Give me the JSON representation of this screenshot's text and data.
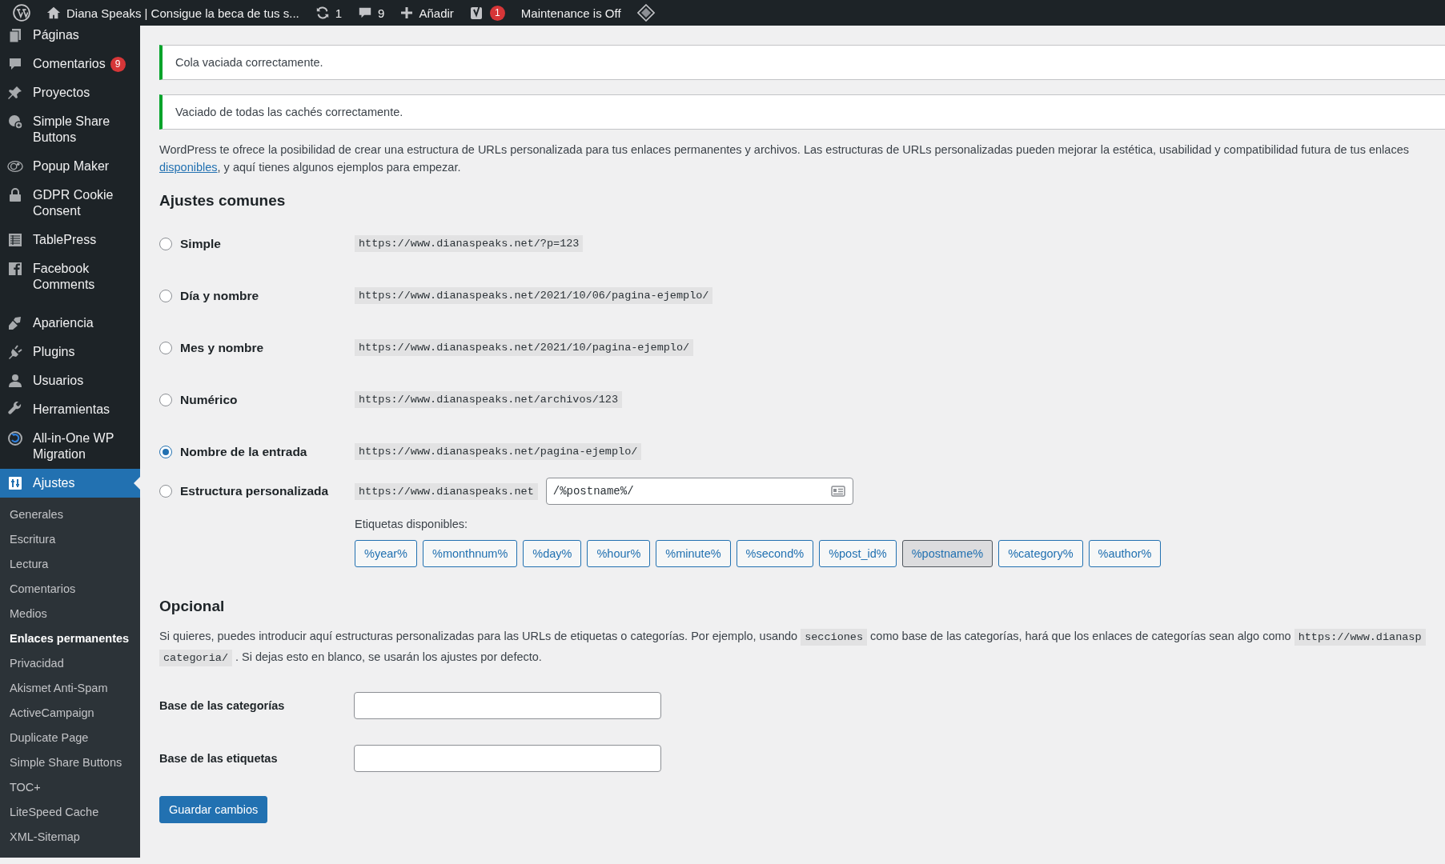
{
  "admin_bar": {
    "site_title": "Diana Speaks | Consigue la beca de tus s...",
    "updates": "1",
    "comments": "9",
    "new_label": "Añadir",
    "seo_badge": "1",
    "maintenance": "Maintenance is Off"
  },
  "sidebar": {
    "items": [
      {
        "label": "Páginas",
        "selected": false
      },
      {
        "label": "Comentarios",
        "badge": "9",
        "selected": false
      },
      {
        "label": "Proyectos",
        "selected": false
      },
      {
        "label": "Simple Share Buttons",
        "selected": false
      },
      {
        "label": "Popup Maker",
        "selected": false
      },
      {
        "label": "GDPR Cookie Consent",
        "selected": false
      },
      {
        "label": "TablePress",
        "selected": false
      },
      {
        "label": "Facebook Comments",
        "selected": false
      },
      {
        "label": "Apariencia",
        "selected": false
      },
      {
        "label": "Plugins",
        "selected": false
      },
      {
        "label": "Usuarios",
        "selected": false
      },
      {
        "label": "Herramientas",
        "selected": false
      },
      {
        "label": "All-in-One WP Migration",
        "selected": false
      },
      {
        "label": "Ajustes",
        "selected": true
      }
    ],
    "submenu": [
      {
        "label": "Generales",
        "selected": false
      },
      {
        "label": "Escritura",
        "selected": false
      },
      {
        "label": "Lectura",
        "selected": false
      },
      {
        "label": "Comentarios",
        "selected": false
      },
      {
        "label": "Medios",
        "selected": false
      },
      {
        "label": "Enlaces permanentes",
        "selected": true
      },
      {
        "label": "Privacidad",
        "selected": false
      },
      {
        "label": "Akismet Anti-Spam",
        "selected": false
      },
      {
        "label": "ActiveCampaign",
        "selected": false
      },
      {
        "label": "Duplicate Page",
        "selected": false
      },
      {
        "label": "Simple Share Buttons",
        "selected": false
      },
      {
        "label": "TOC+",
        "selected": false
      },
      {
        "label": "LiteSpeed Cache",
        "selected": false
      },
      {
        "label": "XML-Sitemap",
        "selected": false
      }
    ]
  },
  "notices": [
    {
      "text": "Cola vaciada correctamente."
    },
    {
      "text": "Vaciado de todas las cachés correctamente."
    }
  ],
  "intro": [
    [
      {
        "kind": "text",
        "text": "WordPress te ofrece la posibilidad de crear una estructura de URLs personalizada para tus enlaces permanentes y archivos. Las estructuras de URLs personalizadas pueden mejorar la estética, usabilidad y compatibilidad futura de tus enlaces"
      }
    ],
    [
      {
        "kind": "link",
        "text": "disponibles"
      },
      {
        "kind": "text",
        "text": ", y aquí tienes algunos ejemplos para empezar."
      }
    ]
  ],
  "common_settings": {
    "heading": "Ajustes comunes",
    "options": [
      {
        "kind": "example",
        "label": "Simple",
        "example": "https://www.dianaspeaks.net/?p=123",
        "selected": false
      },
      {
        "kind": "example",
        "label": "Día y nombre",
        "example": "https://www.dianaspeaks.net/2021/10/06/pagina-ejemplo/",
        "selected": false
      },
      {
        "kind": "example",
        "label": "Mes y nombre",
        "example": "https://www.dianaspeaks.net/2021/10/pagina-ejemplo/",
        "selected": false
      },
      {
        "kind": "example",
        "label": "Numérico",
        "example": "https://www.dianaspeaks.net/archivos/123",
        "selected": false
      },
      {
        "kind": "example",
        "label": "Nombre de la entrada",
        "example": "https://www.dianaspeaks.net/pagina-ejemplo/",
        "selected": true
      },
      {
        "kind": "custom",
        "label": "Estructura personalizada",
        "prefix": "https://www.dianaspeaks.net",
        "value": "/%postname%/",
        "selected": false
      }
    ],
    "tags_label": "Etiquetas disponibles:",
    "tags": [
      {
        "label": "%year%",
        "selected": false
      },
      {
        "label": "%monthnum%",
        "selected": false
      },
      {
        "label": "%day%",
        "selected": false
      },
      {
        "label": "%hour%",
        "selected": false
      },
      {
        "label": "%minute%",
        "selected": false
      },
      {
        "label": "%second%",
        "selected": false
      },
      {
        "label": "%post_id%",
        "selected": false
      },
      {
        "label": "%postname%",
        "selected": true
      },
      {
        "label": "%category%",
        "selected": false
      },
      {
        "label": "%author%",
        "selected": false
      }
    ]
  },
  "optional": {
    "heading": "Opcional",
    "description": [
      [
        {
          "kind": "text",
          "text": "Si quieres, puedes introducir aquí estructuras personalizadas para las URLs de etiquetas o categorías. Por ejemplo, usando"
        },
        {
          "kind": "code",
          "text": "secciones"
        },
        {
          "kind": "text",
          "text": "como base de las categorías, hará que los enlaces de categorías sean algo como"
        },
        {
          "kind": "code",
          "text": "https://www.dianasp"
        }
      ],
      [
        {
          "kind": "code",
          "text": "categoria/"
        },
        {
          "kind": "text",
          "text": ". Si dejas esto en blanco, se usarán los ajustes por defecto."
        }
      ]
    ],
    "fields": [
      {
        "label": "Base de las categorías"
      },
      {
        "label": "Base de las etiquetas"
      }
    ]
  },
  "save_button": "Guardar cambios"
}
